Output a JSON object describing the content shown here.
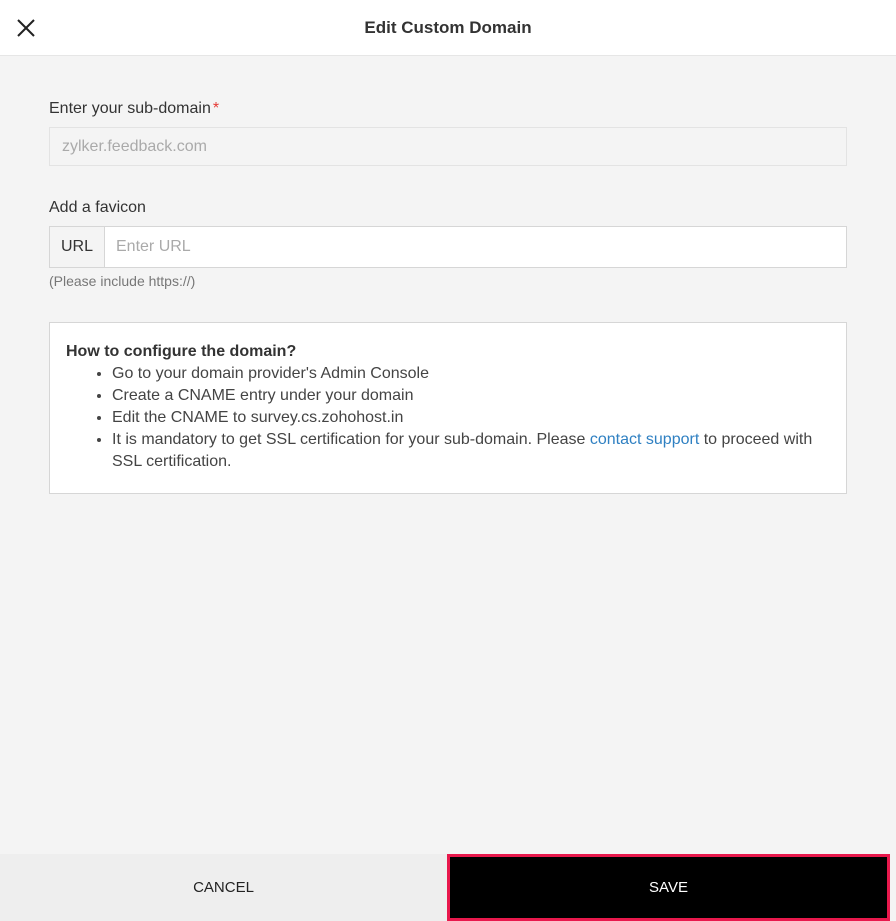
{
  "header": {
    "title": "Edit Custom Domain",
    "close_icon": "close-icon"
  },
  "form": {
    "subdomain": {
      "label": "Enter your sub-domain",
      "required_mark": "*",
      "value": "zylker.feedback.com"
    },
    "favicon": {
      "label": "Add a favicon",
      "prefix": "URL",
      "placeholder": "Enter URL",
      "value": "",
      "hint": "(Please include https://)"
    }
  },
  "info": {
    "title": "How to configure the domain?",
    "steps": [
      "Go to your domain provider's Admin Console",
      "Create a CNAME entry under your domain",
      "Edit the CNAME to survey.cs.zohohost.in"
    ],
    "ssl": {
      "before": "It is mandatory to get SSL certification for your sub-domain. Please ",
      "link": "contact support",
      "after": " to proceed with SSL certification."
    }
  },
  "footer": {
    "cancel_label": "CANCEL",
    "save_label": "SAVE"
  },
  "colors": {
    "required": "#e53935",
    "link": "#2f80c2",
    "save_bg": "#000000",
    "save_highlight": "#e8184c"
  }
}
